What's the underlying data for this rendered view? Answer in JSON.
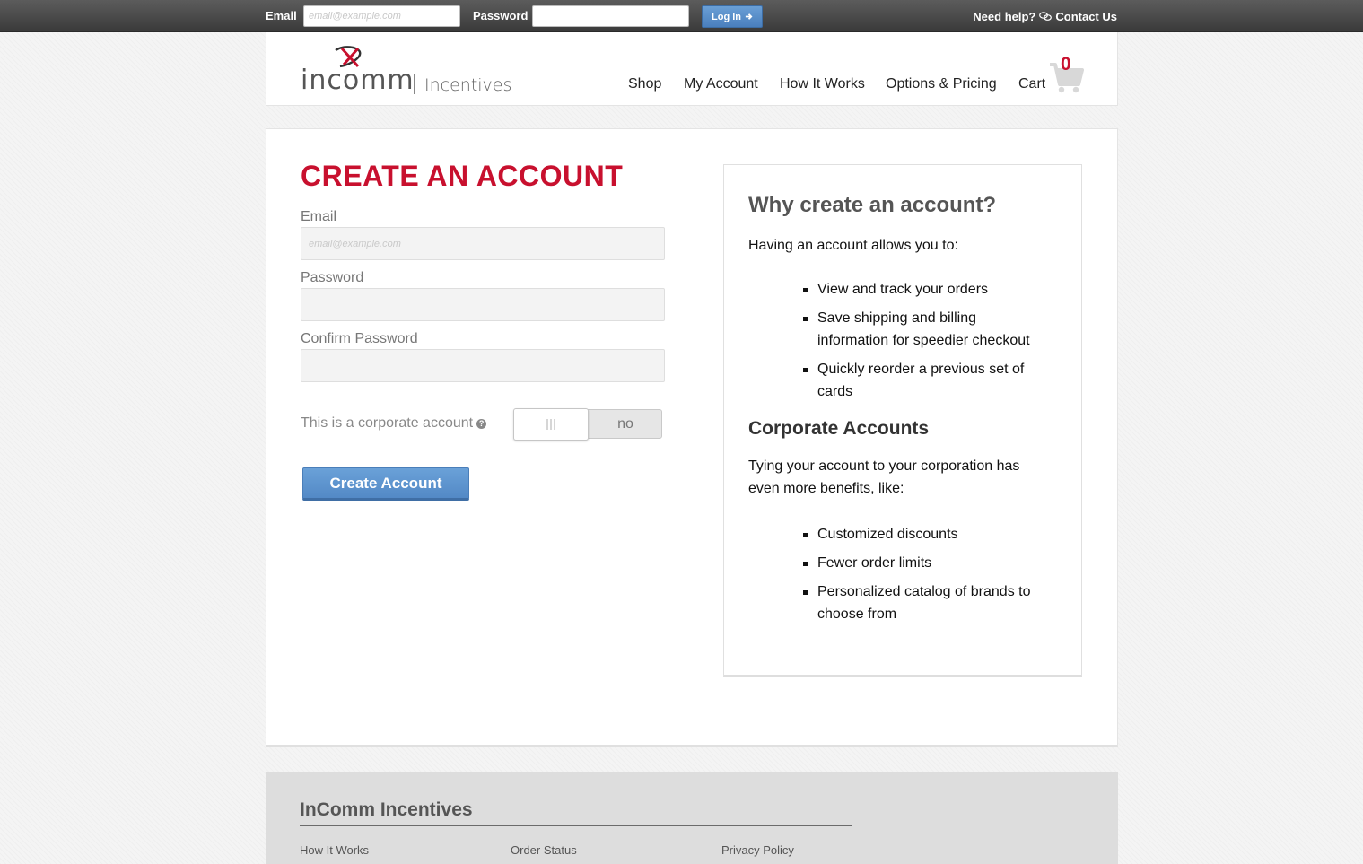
{
  "topbar": {
    "email_label": "Email",
    "email_placeholder": "email@example.com",
    "password_label": "Password",
    "login_button": "Log In",
    "help_text": "Need help?",
    "contact_link": "Contact Us"
  },
  "header": {
    "logo_word": "incomm",
    "logo_sub": "Incentives",
    "nav": [
      "Shop",
      "My Account",
      "How It Works",
      "Options & Pricing",
      "Cart"
    ],
    "cart_count": "0"
  },
  "form": {
    "title": "CREATE AN ACCOUNT",
    "email_label": "Email",
    "email_placeholder": "email@example.com",
    "password_label": "Password",
    "confirm_label": "Confirm Password",
    "corporate_label": "This is a corporate account",
    "corporate_toggle_state": "no",
    "submit_label": "Create Account"
  },
  "why": {
    "heading": "Why create an account?",
    "intro": "Having an account allows you to:",
    "benefits": [
      "View and track your orders",
      "Save shipping and billing information for speedier checkout",
      "Quickly reorder a previous set of cards"
    ],
    "corp_heading": "Corporate Accounts",
    "corp_intro": "Tying your account to your corporation has even more benefits, like:",
    "corp_benefits": [
      "Customized discounts",
      "Fewer order limits",
      "Personalized catalog of brands to choose from"
    ]
  },
  "footer": {
    "title": "InComm Incentives",
    "links": [
      "How It Works",
      "Order Status",
      "Privacy Policy"
    ]
  },
  "colors": {
    "brand_red": "#c8102e",
    "button_blue": "#5a8fcb"
  }
}
